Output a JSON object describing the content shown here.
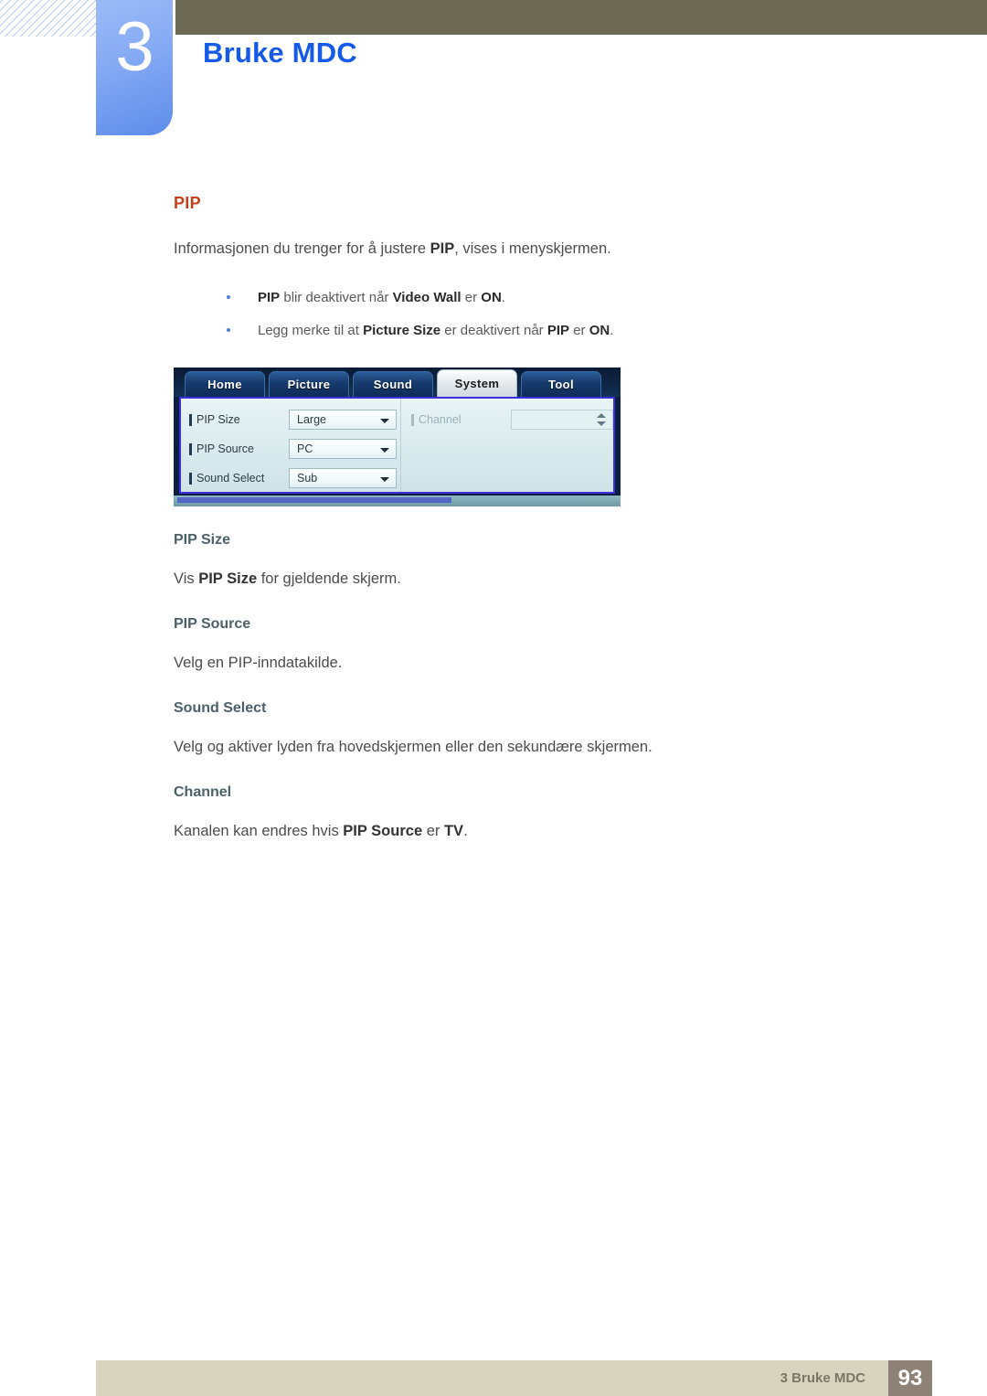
{
  "header": {
    "chapter_number": "3",
    "chapter_title": "Bruke MDC",
    "olive_bar_color": "#6c6a55",
    "chapter_tab_color": "#84a9f4",
    "title_color": "#1559e8"
  },
  "main": {
    "section_title": "PIP",
    "section_title_color": "#c6401b",
    "intro": {
      "before": "Informasjonen du trenger for å justere ",
      "bold": "PIP",
      "after": ", vises i menyskjermen."
    },
    "note": {
      "icon": "note-pencil-icon",
      "items": [
        {
          "p1_bold": "PIP",
          "p2": " blir deaktivert når ",
          "p3_bold": "Video Wall",
          "p4": " er ",
          "p5_bold": "ON",
          "p6": "."
        },
        {
          "p1": "Legg merke til at ",
          "p2_bold": "Picture Size",
          "p3": " er deaktivert når ",
          "p4_bold": "PIP",
          "p5": " er ",
          "p6_bold": "ON",
          "p7": "."
        }
      ]
    },
    "mdc_screenshot": {
      "tabs": [
        {
          "label": "Home",
          "active": false
        },
        {
          "label": "Picture",
          "active": false
        },
        {
          "label": "Sound",
          "active": false
        },
        {
          "label": "System",
          "active": true
        },
        {
          "label": "Tool",
          "active": false
        }
      ],
      "left_fields": [
        {
          "label": "PIP Size",
          "value": "Large",
          "disabled": false
        },
        {
          "label": "PIP Source",
          "value": "PC",
          "disabled": false
        },
        {
          "label": "Sound Select",
          "value": "Sub",
          "disabled": false
        }
      ],
      "right_fields": [
        {
          "label": "Channel",
          "value": "",
          "disabled": true
        }
      ]
    },
    "subsections": [
      {
        "title": "PIP Size",
        "body": {
          "p1": "Vis ",
          "p2_bold": "PIP Size",
          "p3": " for gjeldende skjerm."
        }
      },
      {
        "title": "PIP Source",
        "body": {
          "p1": "Velg en PIP-inndatakilde.",
          "p2_bold": "",
          "p3": ""
        }
      },
      {
        "title": "Sound Select",
        "body": {
          "p1": "Velg og aktiver lyden fra hovedskjermen eller den sekundære skjermen.",
          "p2_bold": "",
          "p3": ""
        }
      },
      {
        "title": "Channel",
        "body": {
          "p1": "Kanalen kan endres hvis ",
          "p2_bold": "PIP Source",
          "p3": " er ",
          "p4_bold": "TV",
          "p5": "."
        }
      }
    ]
  },
  "footer": {
    "label": "3 Bruke MDC",
    "page_number": "93",
    "bar_color": "#d9d4c0",
    "page_box_color": "#8d8275"
  }
}
